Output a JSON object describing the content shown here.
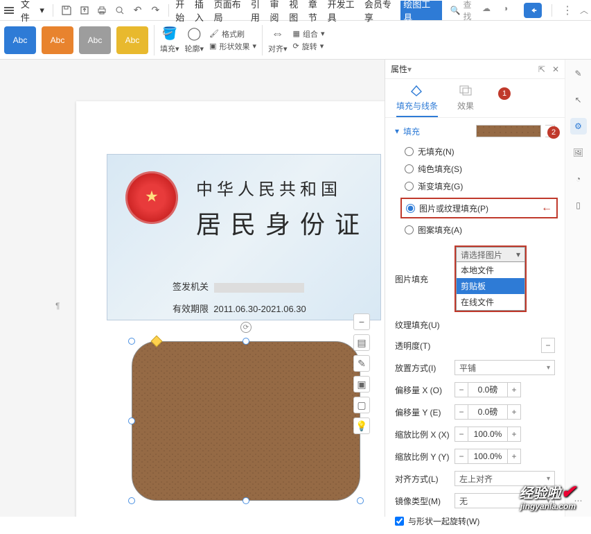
{
  "top": {
    "file": "文件",
    "tabs": [
      "开始",
      "插入",
      "页面布局",
      "引用",
      "审阅",
      "视图",
      "章节",
      "开发工具",
      "会员专享",
      "绘图工具"
    ],
    "active_tab": "绘图工具",
    "search_placeholder": "查找"
  },
  "ribbon": {
    "styles": [
      "Abc",
      "Abc",
      "Abc",
      "Abc"
    ],
    "fill": "填充",
    "outline": "轮廓",
    "format_painter": "格式刷",
    "shape_fx": "形状效果",
    "align": "对齐",
    "group": "组合",
    "rotate": "旋转"
  },
  "id_card": {
    "line1": "中华人民共和国",
    "line2": "居民身份证",
    "issuer_label": "签发机关",
    "validity_label": "有效期限",
    "validity_value": "2011.06.30-2021.06.30"
  },
  "panel": {
    "title": "属性",
    "tab_fill": "填充与线条",
    "tab_fx": "效果",
    "section_fill": "填充",
    "fill_opts": {
      "none": "无填充(N)",
      "solid": "纯色填充(S)",
      "gradient": "渐变填充(G)",
      "picture": "图片或纹理填充(P)",
      "pattern": "图案填充(A)"
    },
    "pic_fill_label": "图片填充",
    "pic_fill_placeholder": "请选择图片",
    "pic_fill_options": [
      "本地文件",
      "剪贴板",
      "在线文件"
    ],
    "pic_fill_highlight": "剪贴板",
    "texture_label": "纹理填充(U)",
    "opacity_label": "透明度(T)",
    "placement_label": "放置方式(I)",
    "placement_value": "平铺",
    "offset_x_label": "偏移量 X (O)",
    "offset_x_value": "0.0磅",
    "offset_y_label": "偏移量 Y (E)",
    "offset_y_value": "0.0磅",
    "scale_x_label": "缩放比例 X (X)",
    "scale_x_value": "100.0%",
    "scale_y_label": "缩放比例 Y (Y)",
    "scale_y_value": "100.0%",
    "align_label": "对齐方式(L)",
    "align_value": "左上对齐",
    "mirror_label": "镜像类型(M)",
    "mirror_value": "无",
    "rotate_with_shape": "与形状一起旋转(W)"
  },
  "badges": {
    "b1": "1",
    "b2": "2"
  },
  "watermark": {
    "title": "经验啦",
    "sub": "jingyanla.com"
  }
}
